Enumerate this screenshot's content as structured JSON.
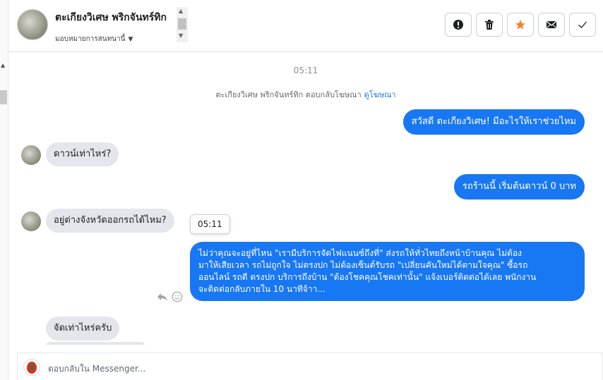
{
  "header": {
    "contact_name": "ตะเกียงวิเศษ พริกจันทร์ทิก",
    "assign_label": "มอบหมายการสนทนานี้"
  },
  "actions": [
    {
      "icon": "exclamation-icon",
      "label": "Mark as spam"
    },
    {
      "icon": "trash-icon",
      "label": "Delete"
    },
    {
      "icon": "star-icon",
      "label": "Star",
      "color": "#f5822b"
    },
    {
      "icon": "envelope-icon",
      "label": "Mark unread"
    },
    {
      "icon": "check-icon",
      "label": "Mark done"
    }
  ],
  "conversation": {
    "timestamp": "05:11",
    "replied_notice": "ตะเกียงวิเศษ พริกจันทร์ทิก ตอบกลับโฆษณา",
    "view_ad_link": "ดูโฆษณา",
    "messages": [
      {
        "side": "out",
        "text": "สวัสดี ตะเกียงวิเศษ! มีอะไรให้เราช่วยไหม"
      },
      {
        "side": "in",
        "text": "ดาวน์เท่าไหร่?"
      },
      {
        "side": "out",
        "text": "รถร้านนี้ เริ่มต้นดาวน์ 0 บาท"
      },
      {
        "side": "in",
        "text": "อยู่ต่างจังหวัดออกรถได้ไหม?"
      },
      {
        "side": "out",
        "lines": [
          "ไม่ว่าคุณจะอยู่ที่ไหน \"เรามีบริการจัดไฟแนนซ์ถึงที่\"  ส่งรถให้ทั่วไทยถึงหน้าบ้านคุณ ไม่ต้อง",
          "มาให้เสียเวลา รถไม่ถูกใจ ไม่ตรงปก ไม่ต้องเซ็นต์รับรถ \"เปลี่ยนคันใหม่ได้ตามใจคุณ\" ซื้อรถ",
          "ออนไลน์ รถดี ตรงปก บริการถึงบ้าน \"ต้องโชคคุณโชคเท่านั้น\" แจ้งเบอร์ติดต่อได้เลย พนักงาน",
          "จะติดต่อกลับภายใน 10 นาทีจ้าา..."
        ]
      },
      {
        "side": "in",
        "text": "จัดเท่าไหร่ครับ"
      }
    ],
    "hover_time": "05:11"
  },
  "composer": {
    "placeholder": "ตอบกลับใน Messenger..."
  },
  "colors": {
    "outgoing_bubble": "#1877f2",
    "incoming_bubble": "#e4e6eb",
    "star": "#f5822b"
  }
}
